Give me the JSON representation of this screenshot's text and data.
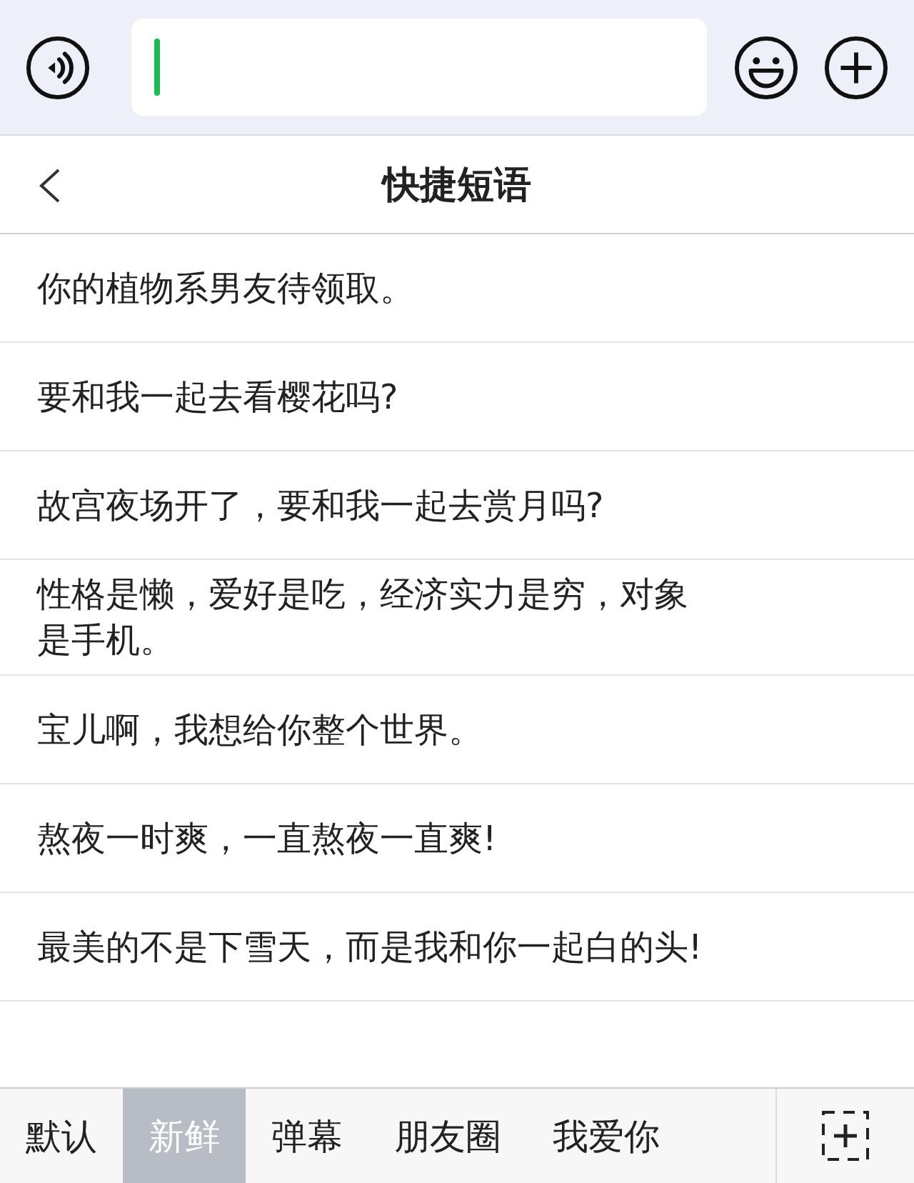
{
  "title": "快捷短语",
  "phrases": [
    "你的植物系男友待领取。",
    "要和我一起去看樱花吗?",
    "故宫夜场开了，要和我一起去赏月吗?",
    "性格是懒，爱好是吃，经济实力是穷，对象是手机。",
    "宝儿啊，我想给你整个世界。",
    "熬夜一时爽，一直熬夜一直爽!",
    "最美的不是下雪天，而是我和你一起白的头!"
  ],
  "tabs": [
    {
      "label": "默认",
      "selected": false
    },
    {
      "label": "新鲜",
      "selected": true
    },
    {
      "label": "弹幕",
      "selected": false
    },
    {
      "label": "朋友圈",
      "selected": false
    },
    {
      "label": "我爱你",
      "selected": false
    }
  ]
}
